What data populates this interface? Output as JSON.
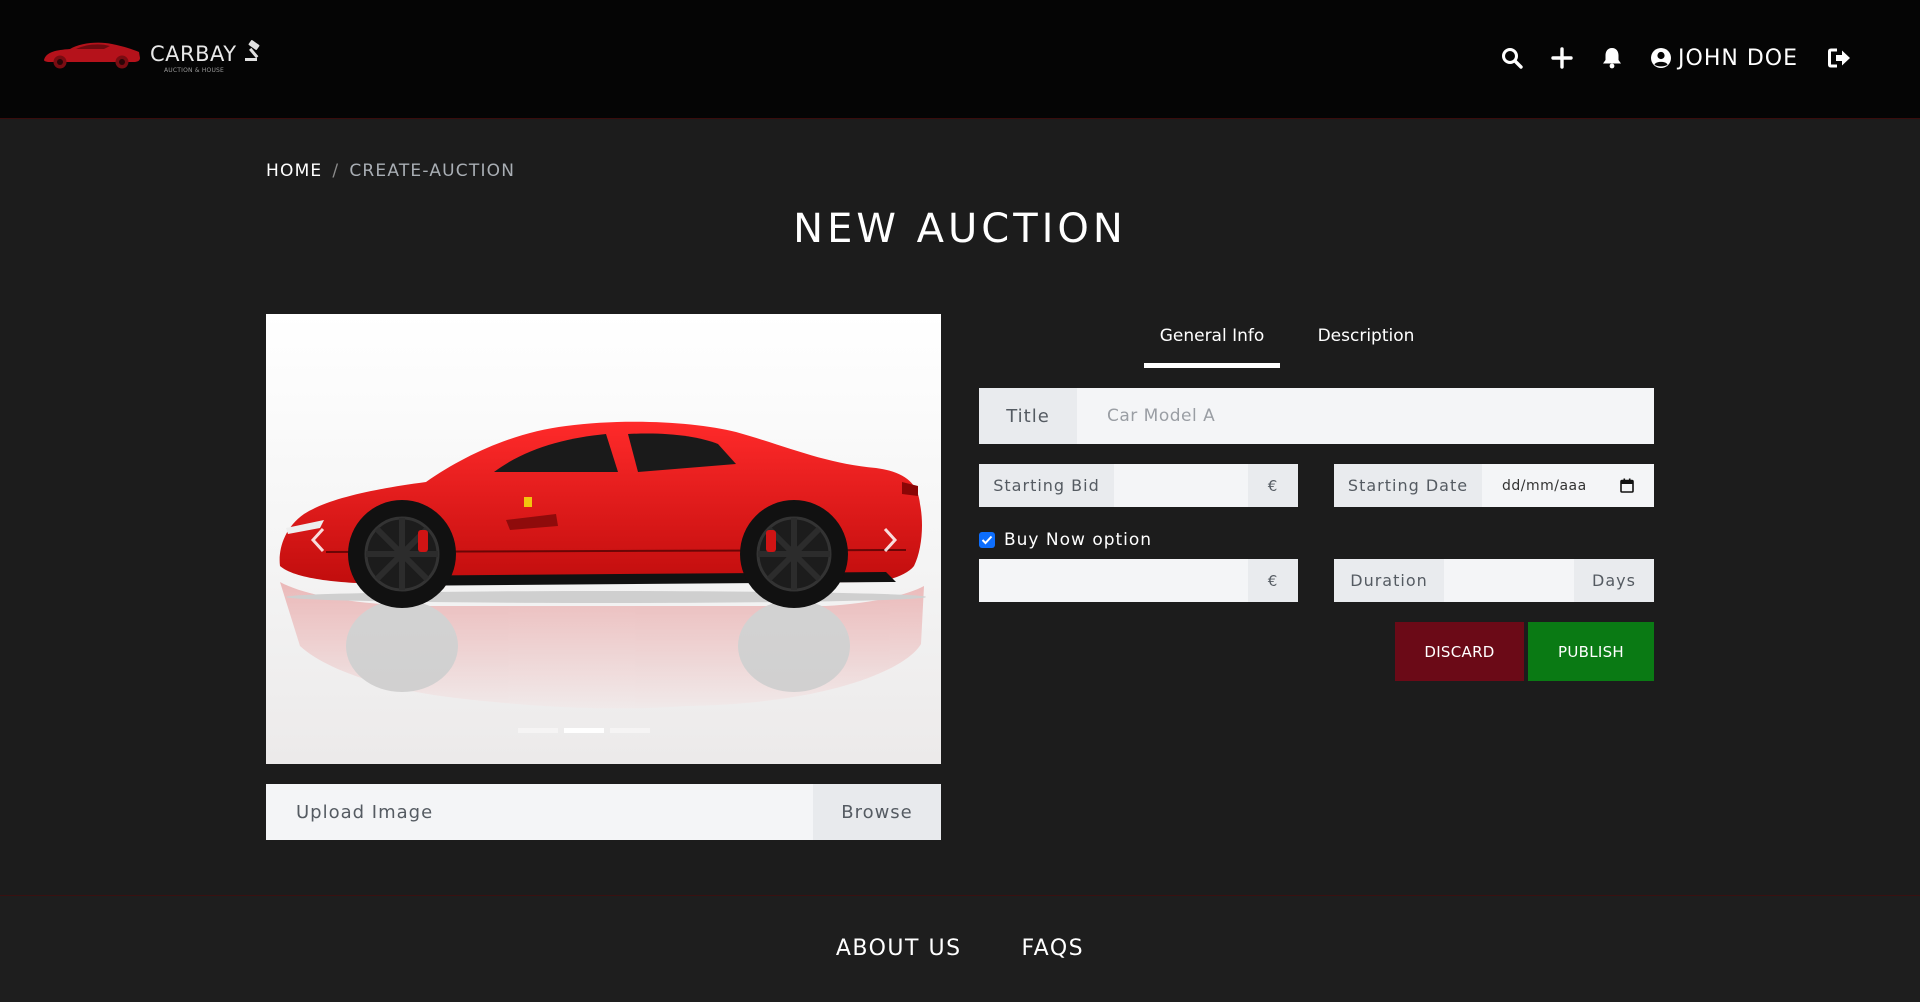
{
  "brand": {
    "name": "CARBAY",
    "tagline": "AUCTION & HOUSE",
    "accent_color": "#c4161c"
  },
  "nav": {
    "icons": [
      "search-icon",
      "plus-icon",
      "bell-icon",
      "user-circle-icon",
      "logout-icon"
    ],
    "user_name": "JOHN DOE"
  },
  "breadcrumb": {
    "home": "HOME",
    "separator": "/",
    "current": "CREATE-AUCTION"
  },
  "page": {
    "title": "NEW AUCTION"
  },
  "image_panel": {
    "upload_placeholder": "Upload Image",
    "browse_label": "Browse",
    "slide_count": 3,
    "active_slide": 2
  },
  "tabs": [
    {
      "label": "General Info",
      "active": true
    },
    {
      "label": "Description",
      "active": false
    }
  ],
  "form": {
    "title_label": "Title",
    "title_placeholder": "Car Model A",
    "starting_bid_label": "Starting Bid",
    "starting_bid_value": "",
    "currency_symbol": "€",
    "starting_date_label": "Starting Date",
    "starting_date_placeholder": "dd/mm/aaa",
    "buy_now_label": "Buy Now option",
    "buy_now_checked": true,
    "buy_now_value": "",
    "duration_label": "Duration",
    "duration_value": "",
    "duration_unit": "Days"
  },
  "actions": {
    "discard_label": "DISCARD",
    "publish_label": "PUBLISH",
    "discard_color": "#6b0a17",
    "publish_color": "#0a7a14"
  },
  "footer": {
    "about_label": "ABOUT US",
    "faqs_label": "FAQS"
  }
}
